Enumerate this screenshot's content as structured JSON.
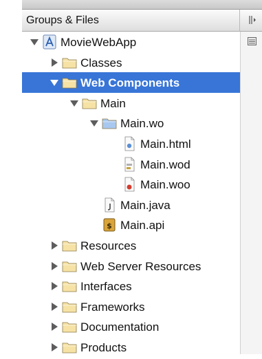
{
  "sidebar": {
    "header": {
      "title": "Groups & Files"
    },
    "tree": [
      {
        "label": "MovieWebApp",
        "icon": "xcode-project-icon",
        "disclosure": "expanded",
        "level": 0
      },
      {
        "label": "Classes",
        "icon": "folder-icon",
        "disclosure": "collapsed",
        "level": 1
      },
      {
        "label": "Web Components",
        "icon": "folder-icon",
        "disclosure": "expanded",
        "level": 1,
        "selected": true
      },
      {
        "label": "Main",
        "icon": "folder-icon",
        "disclosure": "expanded",
        "level": 2
      },
      {
        "label": "Main.wo",
        "icon": "blue-folder-icon",
        "disclosure": "expanded",
        "level": 3
      },
      {
        "label": "Main.html",
        "icon": "html-file-icon",
        "disclosure": "none",
        "level": 4
      },
      {
        "label": "Main.wod",
        "icon": "wod-file-icon",
        "disclosure": "none",
        "level": 4
      },
      {
        "label": "Main.woo",
        "icon": "woo-file-icon",
        "disclosure": "none",
        "level": 4
      },
      {
        "label": "Main.java",
        "icon": "java-file-icon",
        "disclosure": "none",
        "level": 3
      },
      {
        "label": "Main.api",
        "icon": "api-file-icon",
        "disclosure": "none",
        "level": 3
      },
      {
        "label": "Resources",
        "icon": "folder-icon",
        "disclosure": "collapsed",
        "level": 1
      },
      {
        "label": "Web Server Resources",
        "icon": "folder-icon",
        "disclosure": "collapsed",
        "level": 1
      },
      {
        "label": "Interfaces",
        "icon": "folder-icon",
        "disclosure": "collapsed",
        "level": 1
      },
      {
        "label": "Frameworks",
        "icon": "folder-icon",
        "disclosure": "collapsed",
        "level": 1
      },
      {
        "label": "Documentation",
        "icon": "folder-icon",
        "disclosure": "collapsed",
        "level": 1
      },
      {
        "label": "Products",
        "icon": "folder-icon",
        "disclosure": "collapsed",
        "level": 1
      }
    ]
  },
  "colors": {
    "selection": "#3875d7",
    "folder": "#f6e2a4",
    "blue_folder": "#a9c8ef",
    "disclosure": "#5d5d5d"
  }
}
